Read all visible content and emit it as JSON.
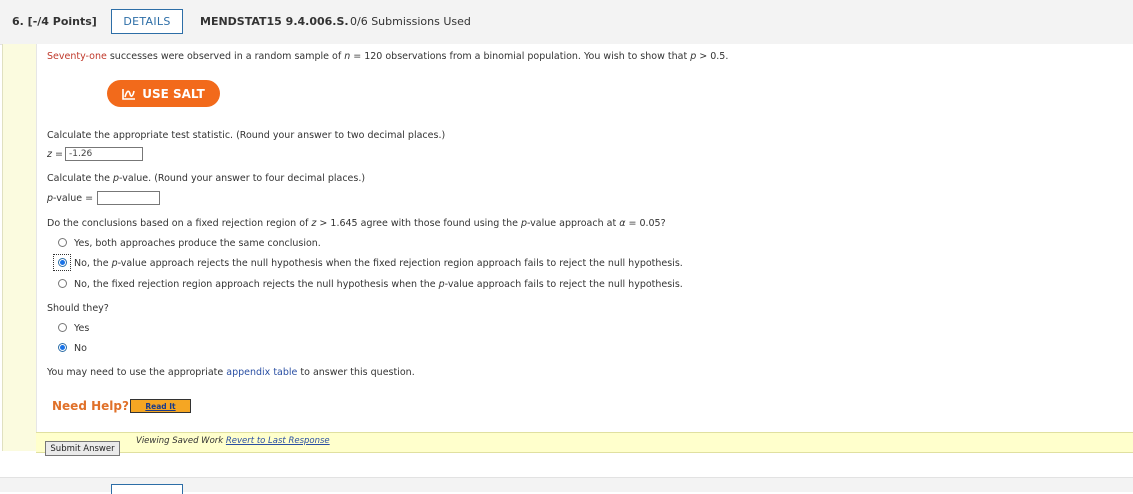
{
  "header": {
    "question_number": "6. [-/4 Points]",
    "details_label": "DETAILS",
    "problem_code": "MENDSTAT15 9.4.006.S.",
    "submissions": "0/6 Submissions Used"
  },
  "problem": {
    "intro_red": "Seventy-one",
    "intro_rest_1": " successes were observed in a random sample of ",
    "n_var": "n",
    "intro_rest_2": " = 120 observations from a binomial population. You wish to show that ",
    "p_var": "p",
    "intro_rest_3": " > 0.5."
  },
  "salt_button": {
    "label": "USE SALT"
  },
  "q1": {
    "prompt": "Calculate the appropriate test statistic. (Round your answer to two decimal places.)",
    "var_label": "z",
    "equals": " =",
    "value": "-1.26"
  },
  "q2": {
    "prompt_1": "Calculate the ",
    "prompt_var": "p",
    "prompt_2": "-value. (Round your answer to four decimal places.)",
    "label_var": "p",
    "label_rest": "-value =",
    "value": ""
  },
  "q3": {
    "prompt_1": "Do the conclusions based on a fixed rejection region of ",
    "z_var": "z",
    "prompt_2": " > 1.645 agree with those found using the ",
    "p_var": "p",
    "prompt_3": "-value approach at ",
    "alpha": "α",
    "prompt_4": " = 0.05?",
    "options": [
      {
        "text": "Yes, both approaches produce the same conclusion.",
        "selected": false
      },
      {
        "pre": "No, the ",
        "var": "p",
        "post": "-value approach rejects the null hypothesis when the fixed rejection region approach fails to reject the null hypothesis.",
        "selected": true
      },
      {
        "pre": "No, the fixed rejection region approach rejects the null hypothesis when the ",
        "var": "p",
        "post": "-value approach fails to reject the null hypothesis.",
        "selected": false
      }
    ]
  },
  "q4": {
    "prompt": "Should they?",
    "options": [
      {
        "text": "Yes",
        "selected": false
      },
      {
        "text": "No",
        "selected": true
      }
    ]
  },
  "appendix_note": {
    "pre": "You may need to use the appropriate ",
    "link": "appendix table",
    "post": " to answer this question."
  },
  "help": {
    "label": "Need Help?",
    "read_it": "Read It"
  },
  "footer": {
    "submit_label": "Submit Answer",
    "viewing_text": "Viewing Saved Work ",
    "revert_link": "Revert to Last Response"
  },
  "colors": {
    "accent": "#2d6ea7",
    "salt_orange": "#f26a1b",
    "help_orange": "#e0712a",
    "red_text": "#c0392b",
    "yellow_bar": "#ffffcc"
  }
}
